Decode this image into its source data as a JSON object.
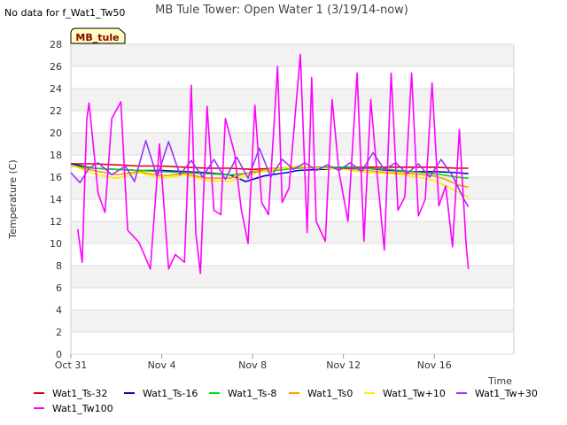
{
  "chart_data": {
    "type": "line",
    "title": "MB Tule Tower: Open Water 1 (3/19/14-now)",
    "no_data_note": "No data for f_Wat1_Tw50",
    "badge": "MB_tule",
    "xlabel": "Time",
    "ylabel": "Temperature (C)",
    "x_range": [
      0,
      19.5
    ],
    "x_ticks": [
      {
        "x": 0,
        "label": "Oct 31"
      },
      {
        "x": 4,
        "label": "Nov 4"
      },
      {
        "x": 8,
        "label": "Nov 8"
      },
      {
        "x": 12,
        "label": "Nov 12"
      },
      {
        "x": 16,
        "label": "Nov 16"
      }
    ],
    "ylim": [
      0,
      28
    ],
    "y_ticks": [
      "0",
      "2",
      "4",
      "6",
      "8",
      "10",
      "12",
      "14",
      "16",
      "18",
      "20",
      "22",
      "24",
      "26",
      "28"
    ],
    "series": [
      {
        "name": "Wat1_Ts-32",
        "color": "#dd0000",
        "x": [
          0,
          1,
          2,
          3,
          4,
          5,
          6,
          7,
          8,
          9,
          10,
          11,
          12,
          13,
          14,
          15,
          16,
          17,
          17.5
        ],
        "y": [
          17.2,
          17.2,
          17.1,
          17.0,
          17.0,
          16.9,
          16.8,
          16.8,
          16.7,
          16.8,
          16.9,
          16.9,
          16.9,
          16.9,
          16.9,
          16.9,
          16.9,
          16.8,
          16.8
        ]
      },
      {
        "name": "Wat1_Ts-16",
        "color": "#0000cc",
        "x": [
          0,
          1,
          2,
          3,
          4,
          5,
          6,
          7,
          7.7,
          8.5,
          9.5,
          10,
          11,
          12,
          13,
          14,
          15,
          16,
          17,
          17.5
        ],
        "y": [
          17.2,
          16.8,
          16.7,
          16.6,
          16.6,
          16.5,
          16.4,
          16.2,
          15.6,
          16.1,
          16.4,
          16.6,
          16.7,
          16.8,
          16.8,
          16.6,
          16.5,
          16.5,
          16.4,
          16.3
        ]
      },
      {
        "name": "Wat1_Ts-8",
        "color": "#00dd00",
        "x": [
          0,
          1,
          2,
          3,
          4,
          5,
          6,
          7,
          8,
          9,
          10,
          11,
          12,
          13,
          14,
          15,
          16,
          17,
          17.5
        ],
        "y": [
          17.0,
          16.8,
          16.7,
          16.6,
          16.5,
          16.4,
          16.3,
          16.2,
          16.4,
          16.6,
          16.8,
          16.9,
          16.9,
          16.8,
          16.7,
          16.5,
          16.3,
          16.0,
          15.9
        ]
      },
      {
        "name": "Wat1_Ts0",
        "color": "#ff9900",
        "x": [
          0,
          1,
          2,
          3,
          4,
          5,
          6,
          7,
          8,
          9,
          10,
          11,
          12,
          13,
          14,
          15,
          16,
          16.5,
          17,
          17.5
        ],
        "y": [
          17.0,
          16.6,
          16.2,
          16.5,
          16.1,
          16.3,
          15.9,
          15.9,
          16.5,
          16.8,
          16.9,
          16.8,
          16.7,
          16.6,
          16.4,
          16.3,
          16.1,
          15.8,
          15.3,
          15.1
        ]
      },
      {
        "name": "Wat1_Tw+10",
        "color": "#ffee00",
        "x": [
          0,
          1,
          2,
          3,
          4,
          5,
          6,
          7,
          8,
          9,
          10,
          11,
          12,
          13,
          14,
          15,
          16,
          16.5,
          17,
          17.5
        ],
        "y": [
          17.1,
          16.3,
          15.9,
          16.4,
          15.9,
          16.2,
          15.7,
          15.6,
          16.3,
          16.7,
          17.0,
          16.8,
          16.7,
          16.4,
          16.3,
          16.1,
          15.7,
          15.2,
          14.7,
          14.2
        ]
      },
      {
        "name": "Wat1_Tw+30",
        "color": "#9933ff",
        "x": [
          0,
          0.4,
          0.8,
          1.2,
          1.8,
          2.4,
          2.8,
          3.3,
          3.8,
          4.3,
          4.8,
          5.3,
          5.8,
          6.3,
          6.8,
          7.3,
          7.8,
          8.3,
          8.8,
          9.3,
          9.8,
          10.3,
          10.8,
          11.3,
          11.8,
          12.3,
          12.8,
          13.3,
          13.8,
          14.3,
          14.8,
          15.3,
          15.8,
          16.3,
          16.8,
          17.3,
          17.5
        ],
        "y": [
          16.4,
          15.5,
          16.8,
          17.3,
          16.2,
          17.0,
          15.6,
          19.3,
          16.0,
          19.2,
          16.2,
          17.5,
          16.0,
          17.6,
          15.8,
          17.8,
          15.9,
          18.6,
          16.0,
          17.6,
          16.7,
          17.3,
          16.6,
          17.1,
          16.6,
          17.3,
          16.5,
          18.2,
          16.7,
          17.3,
          16.3,
          17.2,
          16.0,
          17.6,
          16.1,
          14.0,
          13.3
        ]
      },
      {
        "name": "Wat1_Tw100",
        "color": "#ff00ff",
        "x": [
          0.3,
          0.5,
          0.7,
          0.8,
          1.2,
          1.5,
          1.8,
          2.2,
          2.5,
          3.0,
          3.5,
          3.9,
          4.3,
          4.6,
          5.0,
          5.3,
          5.5,
          5.7,
          6.0,
          6.3,
          6.6,
          6.8,
          7.2,
          7.5,
          7.8,
          8.1,
          8.4,
          8.7,
          9.1,
          9.3,
          9.6,
          10.1,
          10.4,
          10.6,
          10.8,
          11.2,
          11.5,
          11.8,
          12.2,
          12.6,
          12.9,
          13.2,
          13.5,
          13.8,
          14.1,
          14.4,
          14.7,
          15.0,
          15.3,
          15.6,
          15.9,
          16.2,
          16.5,
          16.8,
          17.1,
          17.4,
          17.5
        ],
        "y": [
          11.3,
          8.3,
          21.2,
          22.7,
          14.5,
          12.8,
          21.3,
          22.8,
          11.2,
          10.1,
          7.7,
          19.0,
          7.7,
          9.0,
          8.3,
          24.3,
          11.0,
          7.3,
          22.4,
          13.0,
          12.6,
          21.3,
          18.2,
          13.1,
          10.0,
          22.5,
          13.7,
          12.6,
          26.0,
          13.7,
          15.0,
          27.1,
          11.0,
          25.0,
          12.0,
          10.2,
          23.0,
          16.5,
          12.0,
          25.4,
          10.2,
          23.0,
          15.8,
          9.4,
          25.4,
          13.0,
          14.2,
          25.4,
          12.5,
          14.0,
          24.5,
          13.4,
          15.2,
          9.7,
          20.3,
          9.8,
          7.7
        ]
      }
    ]
  },
  "legend": [
    {
      "label": "Wat1_Ts-32",
      "color": "#dd0000"
    },
    {
      "label": "Wat1_Ts-16",
      "color": "#0000cc"
    },
    {
      "label": "Wat1_Ts-8",
      "color": "#00dd00"
    },
    {
      "label": "Wat1_Ts0",
      "color": "#ff9900"
    },
    {
      "label": "Wat1_Tw+10",
      "color": "#ffee00"
    },
    {
      "label": "Wat1_Tw+30",
      "color": "#9933ff"
    },
    {
      "label": "Wat1_Tw100",
      "color": "#ff00ff"
    }
  ]
}
